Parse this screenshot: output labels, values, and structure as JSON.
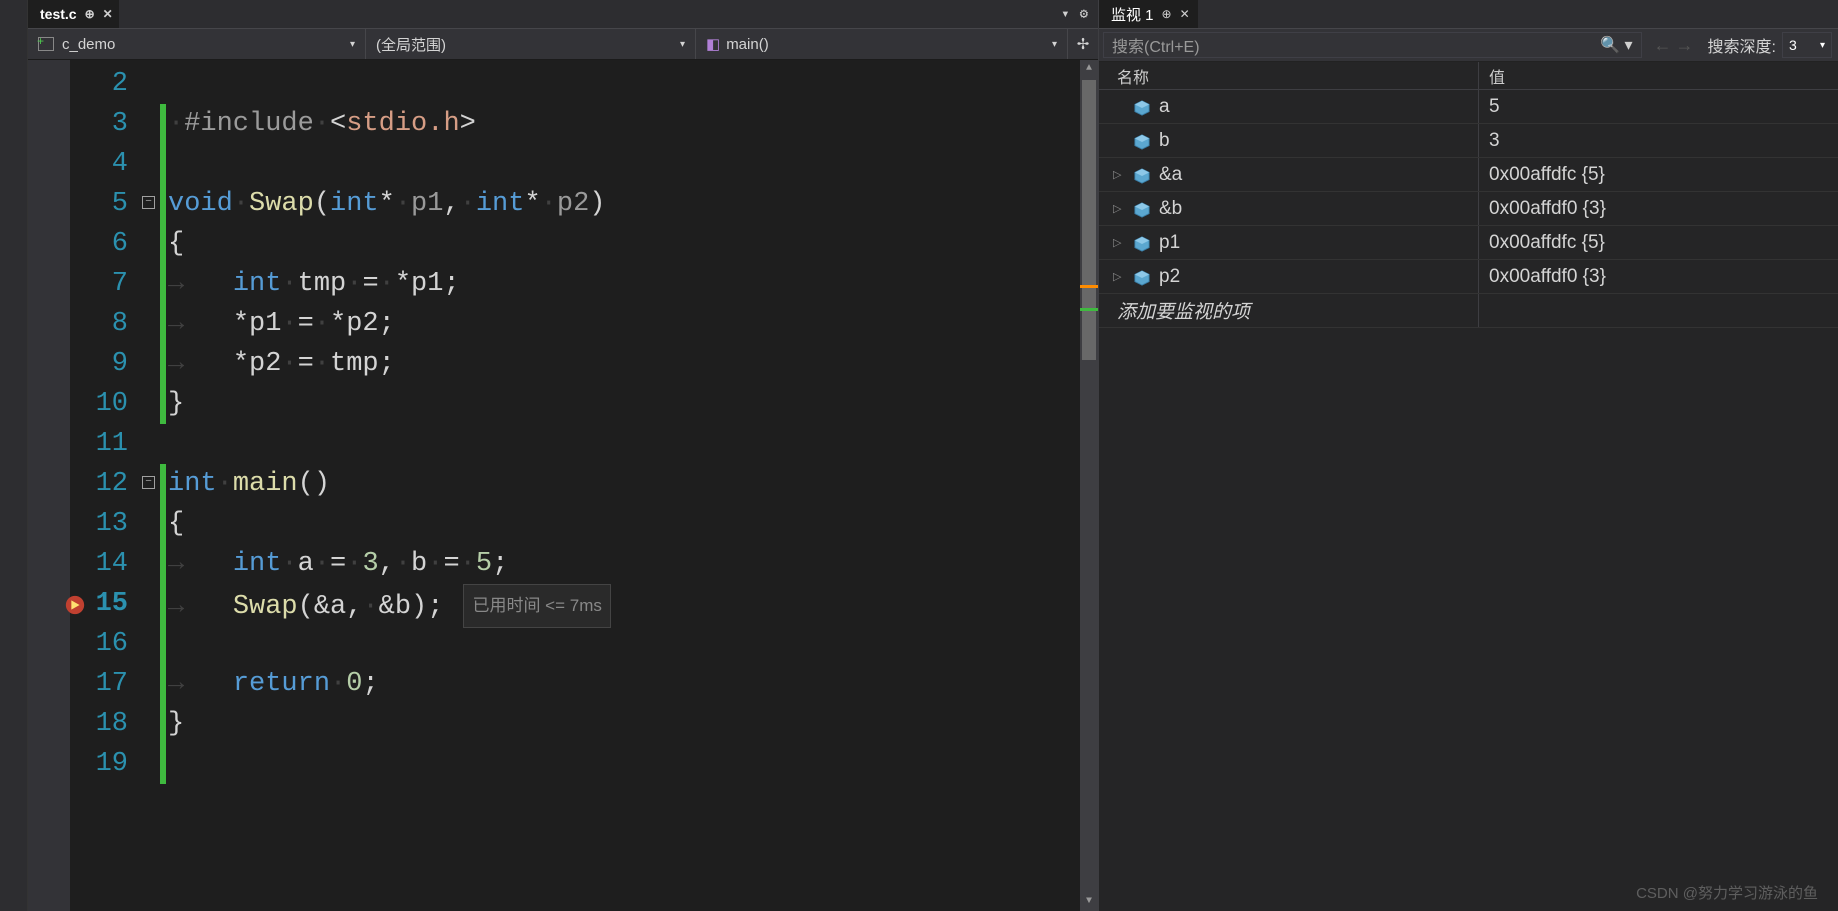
{
  "tab": {
    "filename": "test.c"
  },
  "toolbar": {
    "gear_icon": "settings",
    "dropdown_icon": "▾"
  },
  "navbar": {
    "project": "c_demo",
    "scope": "(全局范围)",
    "function": "main()"
  },
  "editor": {
    "line_start": 2,
    "line_end": 19,
    "current_line": 15,
    "perf_tip": "已用时间 <= 7ms",
    "lines": [
      {
        "n": 2,
        "tokens": []
      },
      {
        "n": 3,
        "indent": 0,
        "raw": "#include <stdio.h>"
      },
      {
        "n": 4,
        "tokens": []
      },
      {
        "n": 5,
        "raw": "void Swap(int* p1, int* p2)"
      },
      {
        "n": 6,
        "raw": "{"
      },
      {
        "n": 7,
        "raw": "    int tmp = *p1;"
      },
      {
        "n": 8,
        "raw": "    *p1 = *p2;"
      },
      {
        "n": 9,
        "raw": "    *p2 = tmp;"
      },
      {
        "n": 10,
        "raw": "}"
      },
      {
        "n": 11,
        "tokens": []
      },
      {
        "n": 12,
        "raw": "int main()"
      },
      {
        "n": 13,
        "raw": "{"
      },
      {
        "n": 14,
        "raw": "    int a = 3, b = 5;"
      },
      {
        "n": 15,
        "raw": "    Swap(&a, &b);"
      },
      {
        "n": 16,
        "tokens": []
      },
      {
        "n": 17,
        "raw": "    return 0;"
      },
      {
        "n": 18,
        "raw": "}"
      },
      {
        "n": 19,
        "tokens": []
      }
    ]
  },
  "watch": {
    "panel_title": "监视 1",
    "search_placeholder": "搜索(Ctrl+E)",
    "depth_label": "搜索深度:",
    "depth_value": "3",
    "columns": {
      "name": "名称",
      "value": "值"
    },
    "rows": [
      {
        "expandable": false,
        "name": "a",
        "value": "5"
      },
      {
        "expandable": false,
        "name": "b",
        "value": "3"
      },
      {
        "expandable": true,
        "name": "&a",
        "value": "0x00affdfc {5}"
      },
      {
        "expandable": true,
        "name": "&b",
        "value": "0x00affdf0 {3}"
      },
      {
        "expandable": true,
        "name": "p1",
        "value": "0x00affdfc {5}"
      },
      {
        "expandable": true,
        "name": "p2",
        "value": "0x00affdf0 {3}"
      }
    ],
    "add_item": "添加要监视的项"
  },
  "watermark": "CSDN @努力学习游泳的鱼"
}
